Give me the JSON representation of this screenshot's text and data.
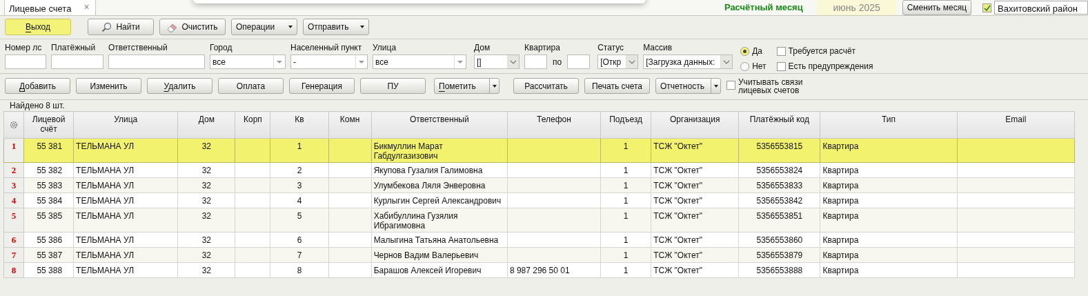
{
  "tab": {
    "label": "Лицевые счета",
    "close": "×"
  },
  "period": {
    "label": "Расчётный месяц",
    "value": "июнь 2025",
    "button": "Сменить месяц"
  },
  "district": {
    "checked": true,
    "value": "Вахитовский район"
  },
  "toolbar": [
    {
      "label": "Выход",
      "kind": "primary",
      "mnemonic": true
    },
    {
      "label": "Найти",
      "kind": "search",
      "mnemonic": false
    },
    {
      "label": "Очистить",
      "kind": "clear",
      "mnemonic": false
    },
    {
      "label": "Операции",
      "kind": "menu",
      "mnemonic": false
    },
    {
      "label": "Отправить",
      "kind": "menu",
      "mnemonic": false
    }
  ],
  "filters": [
    {
      "label": "Номер лс",
      "kind": "text"
    },
    {
      "label": "Платёжный",
      "kind": "text"
    },
    {
      "label": "Ответственный",
      "kind": "text"
    },
    {
      "label": "Город",
      "kind": "select",
      "value": "все"
    },
    {
      "label": "Населенный пункт",
      "kind": "select",
      "value": "-"
    },
    {
      "label": "Улица",
      "kind": "select",
      "value": "все"
    },
    {
      "label": "Дом",
      "kind": "combo",
      "value": "[]"
    },
    {
      "label": "Квартира",
      "kind": "range",
      "between": "по"
    },
    {
      "label": "Статус",
      "kind": "combo",
      "value": "[Откр"
    },
    {
      "label": "Массив",
      "kind": "combo",
      "value": "[Загрузка данных:"
    }
  ],
  "radios": [
    {
      "label": "Да",
      "selected": true
    },
    {
      "label": "Нет",
      "selected": false
    }
  ],
  "flags": [
    {
      "label": "Требуется расчёт",
      "checked": false
    },
    {
      "label": "Есть предупреждения",
      "checked": false
    }
  ],
  "actions": [
    {
      "label": "Добавить",
      "kind": "plain",
      "mnemonic": true
    },
    {
      "label": "Изменить",
      "kind": "plain",
      "mnemonic": false
    },
    {
      "label": "Удалить",
      "kind": "plain",
      "mnemonic": true
    },
    {
      "label": "Оплата",
      "kind": "plain",
      "mnemonic": false
    },
    {
      "label": "Генерация",
      "kind": "plain",
      "mnemonic": false
    },
    {
      "label": "ПУ",
      "kind": "plain",
      "mnemonic": false
    },
    {
      "label": "Пометить",
      "kind": "split",
      "mnemonic": true
    },
    {
      "label": "Рассчитать",
      "kind": "plain",
      "mnemonic": false
    },
    {
      "label": "Печать счета",
      "kind": "plain",
      "mnemonic": false
    },
    {
      "label": "Отчетность",
      "kind": "split",
      "mnemonic": false
    }
  ],
  "link_accounts": {
    "label": "Учитывать связи лицевых счетов",
    "checked": false
  },
  "found": "Найдено 8 шт.",
  "table": {
    "columns": [
      "Лицевой счёт",
      "Улица",
      "Дом",
      "Корп",
      "Кв",
      "Комн",
      "Ответственный",
      "Телефон",
      "Подъезд",
      "Организация",
      "Платёжный код",
      "Тип",
      "Email"
    ],
    "rows": [
      {
        "number": "1",
        "selected": true,
        "cells": [
          "55 381",
          "ТЕЛЬМАНА УЛ",
          "32",
          "",
          "1",
          "",
          "Бикмуллин Марат Габдулгазизович",
          "",
          "1",
          "ТСЖ \"Октет\"",
          "5356553815",
          "Квартира",
          ""
        ]
      },
      {
        "number": "2",
        "selected": false,
        "cells": [
          "55 382",
          "ТЕЛЬМАНА УЛ",
          "32",
          "",
          "2",
          "",
          "Якупова Гузалия Галимовна",
          "",
          "1",
          "ТСЖ \"Октет\"",
          "5356553824",
          "Квартира",
          ""
        ]
      },
      {
        "number": "3",
        "selected": false,
        "cells": [
          "55 383",
          "ТЕЛЬМАНА УЛ",
          "32",
          "",
          "3",
          "",
          "Улумбекова Ляля Энверовна",
          "",
          "1",
          "ТСЖ \"Октет\"",
          "5356553833",
          "Квартира",
          ""
        ]
      },
      {
        "number": "4",
        "selected": false,
        "cells": [
          "55 384",
          "ТЕЛЬМАНА УЛ",
          "32",
          "",
          "4",
          "",
          "Курлыгин Сергей Александрович",
          "",
          "1",
          "ТСЖ \"Октет\"",
          "5356553842",
          "Квартира",
          ""
        ]
      },
      {
        "number": "5",
        "selected": false,
        "cells": [
          "55 385",
          "ТЕЛЬМАНА УЛ",
          "32",
          "",
          "5",
          "",
          "Хабибуллина Гузялия Ибрагимовна",
          "",
          "1",
          "ТСЖ \"Октет\"",
          "5356553851",
          "Квартира",
          ""
        ]
      },
      {
        "number": "6",
        "selected": false,
        "cells": [
          "55 386",
          "ТЕЛЬМАНА УЛ",
          "32",
          "",
          "6",
          "",
          "Малыгина Татьяна Анатольевна",
          "",
          "1",
          "ТСЖ \"Октет\"",
          "5356553860",
          "Квартира",
          ""
        ]
      },
      {
        "number": "7",
        "selected": false,
        "cells": [
          "55 387",
          "ТЕЛЬМАНА УЛ",
          "32",
          "",
          "7",
          "",
          "Чернов Вадим Валерьевич",
          "",
          "1",
          "ТСЖ \"Октет\"",
          "5356553879",
          "Квартира",
          ""
        ]
      },
      {
        "number": "8",
        "selected": false,
        "cells": [
          "55 388",
          "ТЕЛЬМАНА УЛ",
          "32",
          "",
          "8",
          "",
          "Барашов Алексей Игоревич",
          "8 987 296 50 01",
          "1",
          "ТСЖ \"Октет\"",
          "5356553888",
          "Квартира",
          ""
        ]
      }
    ]
  }
}
